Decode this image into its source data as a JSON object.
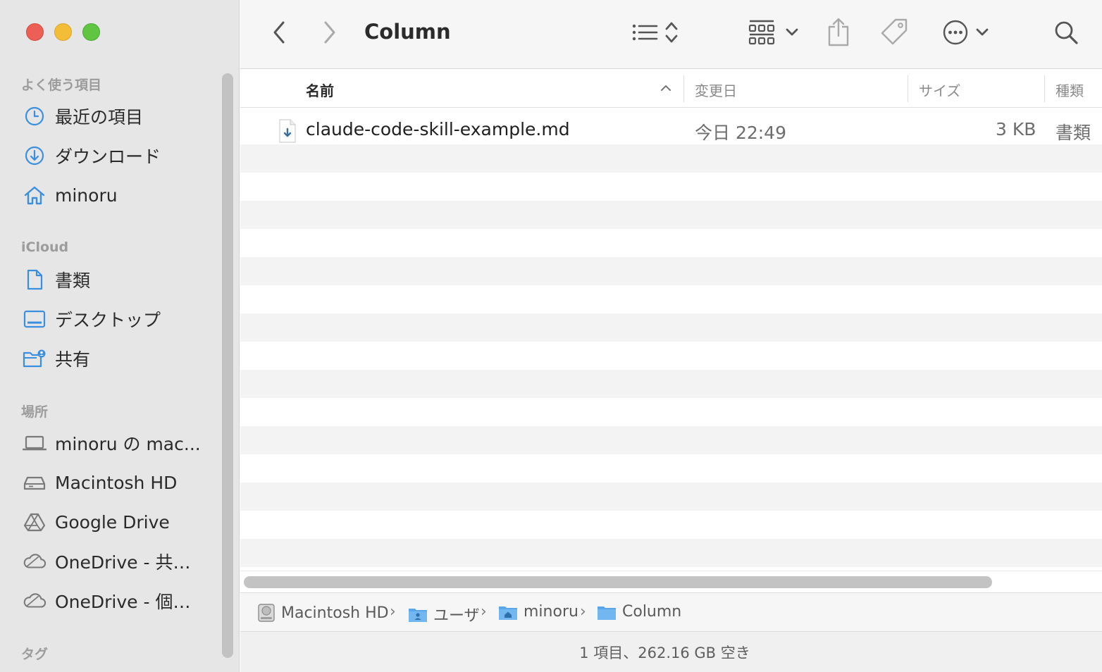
{
  "window": {
    "title": "Column"
  },
  "sidebar": {
    "sections": {
      "favorites": "よく使う項目",
      "icloud": "iCloud",
      "locations": "場所",
      "tags": "タグ"
    },
    "favorites": [
      {
        "label": "最近の項目",
        "icon": "clock-icon"
      },
      {
        "label": "ダウンロード",
        "icon": "download-icon"
      },
      {
        "label": "minoru",
        "icon": "home-icon"
      }
    ],
    "icloud": [
      {
        "label": "書類",
        "icon": "document-icon"
      },
      {
        "label": "デスクトップ",
        "icon": "desktop-icon"
      },
      {
        "label": "共有",
        "icon": "shared-folder-icon"
      }
    ],
    "locations": [
      {
        "label": "minoru の mac...",
        "icon": "laptop-icon"
      },
      {
        "label": "Macintosh HD",
        "icon": "disk-icon"
      },
      {
        "label": "Google Drive",
        "icon": "google-drive-icon"
      },
      {
        "label": "OneDrive - 共…",
        "icon": "cloud-icon"
      },
      {
        "label": "OneDrive - 個…",
        "icon": "cloud-icon"
      }
    ]
  },
  "columns": {
    "name": "名前",
    "modified": "変更日",
    "size": "サイズ",
    "kind": "種類"
  },
  "files": [
    {
      "name": "claude-code-skill-example.md",
      "modified": "今日 22:49",
      "size": "3 KB",
      "kind": "書類"
    }
  ],
  "pathbar": [
    {
      "label": "Macintosh HD",
      "icon": "disk-icon"
    },
    {
      "label": "ユーザ",
      "icon": "users-folder-icon"
    },
    {
      "label": "minoru",
      "icon": "home-folder-icon"
    },
    {
      "label": "Column",
      "icon": "folder-icon"
    }
  ],
  "status": {
    "text": "1 項目、262.16 GB 空き"
  },
  "colors": {
    "accent": "#3b8fe0",
    "close": "#ec5f57",
    "minimize": "#f4bd38",
    "zoom": "#5fc543"
  }
}
